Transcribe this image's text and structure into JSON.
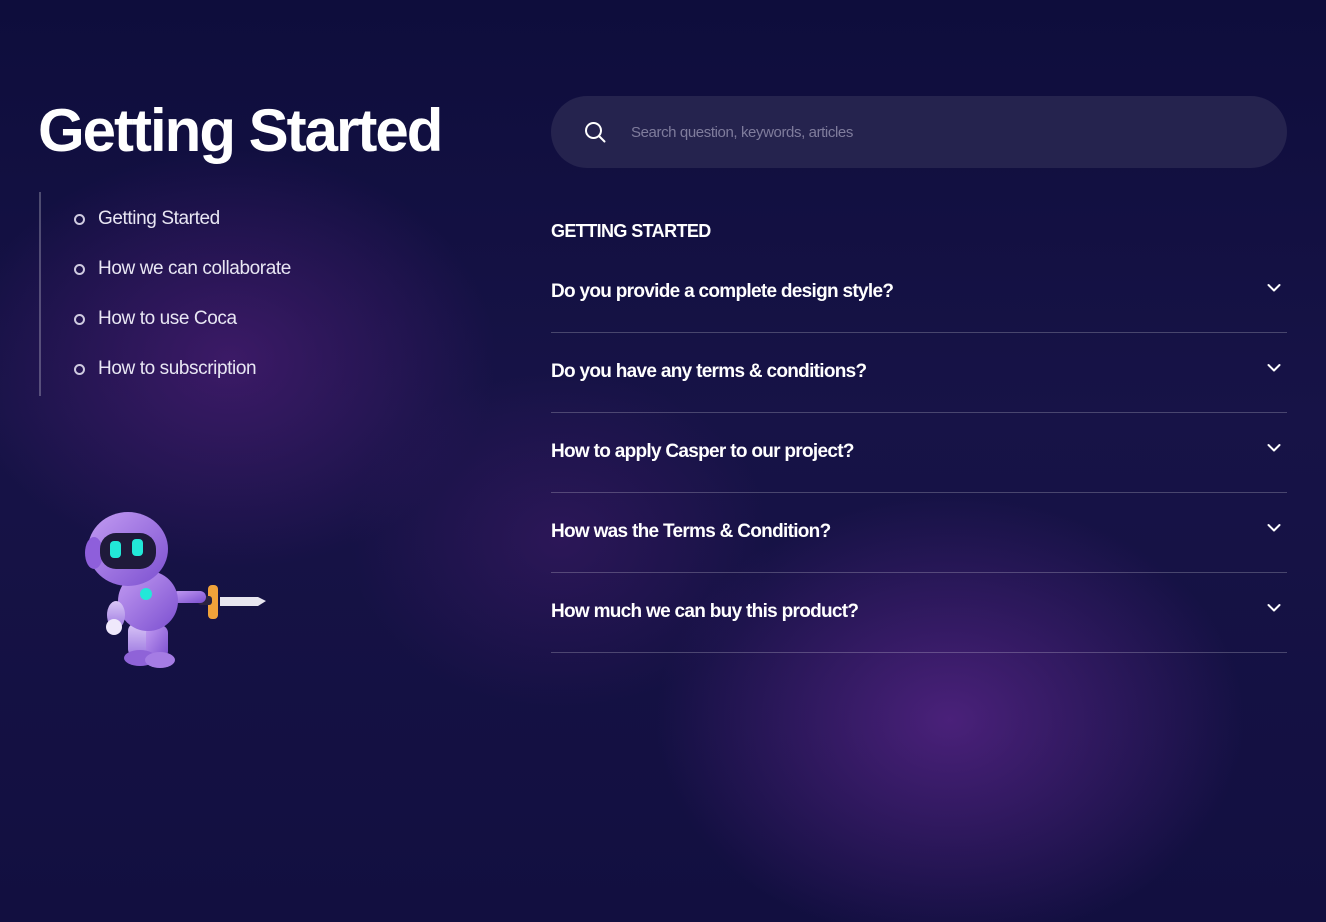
{
  "page": {
    "title": "Getting Started"
  },
  "sidebar": {
    "items": [
      {
        "label": "Getting Started"
      },
      {
        "label": "How we can collaborate"
      },
      {
        "label": "How to use Coca"
      },
      {
        "label": "How to subscription"
      }
    ]
  },
  "search": {
    "placeholder": "Search question, keywords, articles",
    "icon": "search-icon"
  },
  "faq": {
    "heading": "GETTING STARTED",
    "items": [
      {
        "question": "Do you provide a complete design style?"
      },
      {
        "question": "Do you have any terms & conditions?"
      },
      {
        "question": "How to apply Casper to our project?"
      },
      {
        "question": "How was the Terms & Condition?"
      },
      {
        "question": "How much we can buy this product?"
      }
    ]
  },
  "colors": {
    "background": "#0f0c3a",
    "accent_purple": "#5c268c",
    "search_bg": "#25234e",
    "robot_eyes": "#22e8d8",
    "sword_hilt": "#f0a23a"
  },
  "illustration": {
    "icon": "robot-with-sword-icon"
  }
}
